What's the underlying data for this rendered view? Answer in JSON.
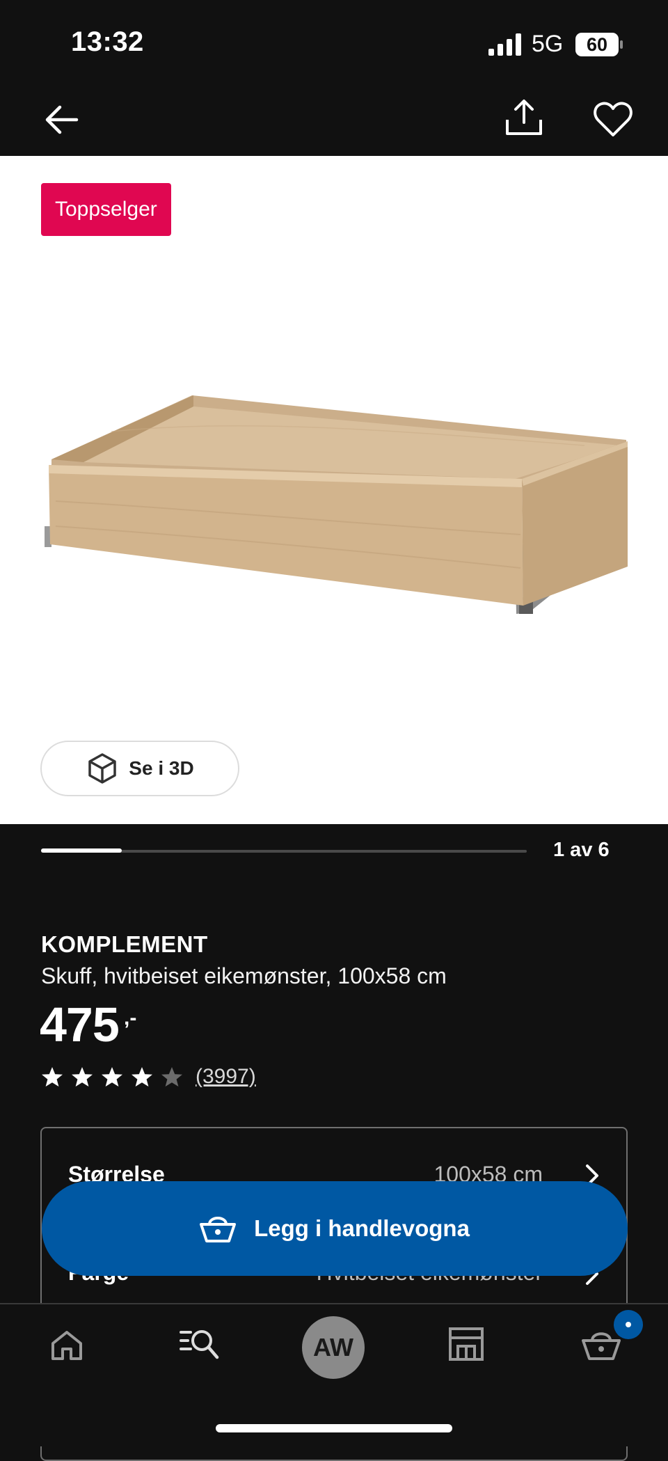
{
  "status_bar": {
    "time": "13:32",
    "network": "5G",
    "battery": "60"
  },
  "product": {
    "badge": "Toppselger",
    "view_3d_label": "Se i 3D",
    "carousel": {
      "label": "1 av 6",
      "current": 1,
      "total": 6
    },
    "name": "KOMPLEMENT",
    "description": "Skuff, hvitbeiset eikemønster, 100x58 cm",
    "price": "475",
    "price_suffix": ",-",
    "rating": 4.5,
    "review_count": "(3997)"
  },
  "options": [
    {
      "label": "Størrelse",
      "value": "100x58 cm"
    },
    {
      "label": "Farge",
      "value": "Hvitbeiset eikemønster"
    }
  ],
  "actions": {
    "add_to_cart": "Legg i handlevogna"
  },
  "tabbar": {
    "avatar_initials": "AW"
  },
  "colors": {
    "badge": "#e00751",
    "primary_button": "#0058a3",
    "background": "#111111"
  }
}
